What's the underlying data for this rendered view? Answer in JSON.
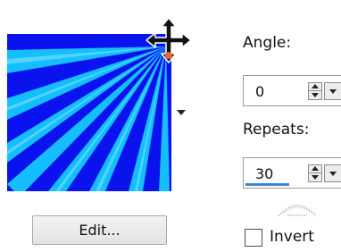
{
  "angle": {
    "label": "Angle:",
    "value": "0"
  },
  "repeats": {
    "label": "Repeats:",
    "value": "30",
    "field_fill_fraction": 0.45
  },
  "edit_button": {
    "label": "Edit..."
  },
  "invert": {
    "label": "Invert",
    "checked": false
  },
  "icons": [
    "move-cursor-icon",
    "dropdown-arrow-icon",
    "spin-up-down-icon",
    "spin-dropdown-icon",
    "invert-badge-icon"
  ],
  "colors": {
    "gradient_blue": "#0a12ee",
    "gradient_cyan": "#16c8ff",
    "button_border": "#a8a8a8",
    "progress": "#3c86d8"
  }
}
